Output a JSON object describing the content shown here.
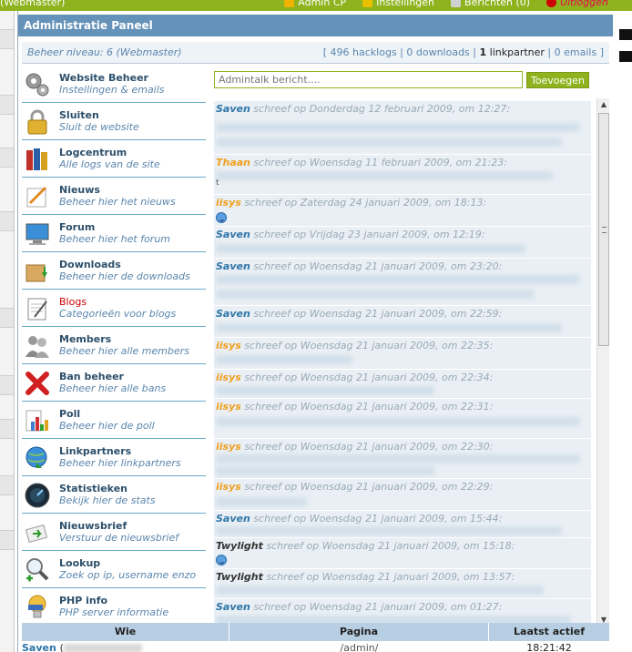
{
  "topbar": {
    "session": "(Webmaster)",
    "links": [
      {
        "label": "Admin CP",
        "icon": "admin-icon",
        "color": "#f2b200"
      },
      {
        "label": "Instellingen",
        "icon": "settings-icon",
        "color": "#e8c000"
      },
      {
        "label": "Berichten (0)",
        "icon": "messages-icon",
        "color": "#c0c0c0"
      },
      {
        "label": "Uitloggen",
        "icon": "logout-icon",
        "color": "#cc0000"
      }
    ]
  },
  "panel": {
    "title": "Administratie Paneel",
    "level": "Beheer niveau: 6 (Webmaster)",
    "stats": {
      "hacklogs": "496 hacklogs",
      "downloads": "0 downloads",
      "linkpartner_count": "1",
      "linkpartner_label": "linkpartner",
      "emails": "0 emails"
    }
  },
  "menu": [
    {
      "title": "Website Beheer",
      "sub": "Instellingen & emails",
      "icon": "gears-icon"
    },
    {
      "title": "Sluiten",
      "sub": "Sluit de website",
      "icon": "lock-icon"
    },
    {
      "title": "Logcentrum",
      "sub": "Alle logs van de site",
      "icon": "books-icon"
    },
    {
      "title": "Nieuws",
      "sub": "Beheer hier het nieuws",
      "icon": "news-icon"
    },
    {
      "title": "Forum",
      "sub": "Beheer hier het forum",
      "icon": "monitor-icon"
    },
    {
      "title": "Downloads",
      "sub": "Beheer hier de downloads",
      "icon": "box-download-icon"
    },
    {
      "title": "Blogs",
      "sub": "Categorieën voor blogs",
      "icon": "notepad-icon",
      "active": true
    },
    {
      "title": "Members",
      "sub": "Beheer hier alle members",
      "icon": "users-icon"
    },
    {
      "title": "Ban beheer",
      "sub": "Beheer hier alle bans",
      "icon": "ban-icon"
    },
    {
      "title": "Poll",
      "sub": "Beheer hier de poll",
      "icon": "poll-chart-icon"
    },
    {
      "title": "Linkpartners",
      "sub": "Beheer hier linkpartners",
      "icon": "globe-link-icon"
    },
    {
      "title": "Statistieken",
      "sub": "Bekijk hier de stats",
      "icon": "gauge-icon"
    },
    {
      "title": "Nieuwsbrief",
      "sub": "Verstuur de nieuwsbrief",
      "icon": "newsletter-icon"
    },
    {
      "title": "Lookup",
      "sub": "Zoek op ip, username enzo",
      "icon": "magnifier-icon"
    },
    {
      "title": "PHP info",
      "sub": "PHP server informatie",
      "icon": "php-info-icon"
    }
  ],
  "chat": {
    "placeholder": "Admintalk bericht....",
    "submit": "Toevoegen",
    "messages": [
      {
        "user": "Saven",
        "color": "blue",
        "meta": "schreef op Donderdag 12 februari 2009, om 12:27:"
      },
      {
        "user": "Thaan",
        "color": "orange",
        "meta": "schreef op Woensdag 11 februari 2009, om 21:23:",
        "lead_text": "t"
      },
      {
        "user": "iisys",
        "color": "orange",
        "meta": "schreef op Zaterdag 24 januari 2009, om 18:13:",
        "smile": true
      },
      {
        "user": "Saven",
        "color": "blue",
        "meta": "schreef op Vrijdag 23 januari 2009, om 12:19:"
      },
      {
        "user": "Saven",
        "color": "blue",
        "meta": "schreef op Woensdag 21 januari 2009, om 23:20:"
      },
      {
        "user": "Saven",
        "color": "blue",
        "meta": "schreef op Woensdag 21 januari 2009, om 22:59:"
      },
      {
        "user": "iisys",
        "color": "orange",
        "meta": "schreef op Woensdag 21 januari 2009, om 22:35:"
      },
      {
        "user": "iisys",
        "color": "orange",
        "meta": "schreef op Woensdag 21 januari 2009, om 22:34:"
      },
      {
        "user": "iisys",
        "color": "orange",
        "meta": "schreef op Woensdag 21 januari 2009, om 22:31:"
      },
      {
        "user": "iisys",
        "color": "orange",
        "meta": "schreef op Woensdag 21 januari 2009, om 22:30:"
      },
      {
        "user": "iisys",
        "color": "orange",
        "meta": "schreef op Woensdag 21 januari 2009, om 22:29:"
      },
      {
        "user": "Saven",
        "color": "blue",
        "meta": "schreef op Woensdag 21 januari 2009, om 15:44:"
      },
      {
        "user": "Twylight",
        "color": "dark",
        "meta": "schreef op Woensdag 21 januari 2009, om 15:18:",
        "smile": true
      },
      {
        "user": "Twylight",
        "color": "dark",
        "meta": "schreef op Woensdag 21 januari 2009, om 13:57:"
      },
      {
        "user": "Saven",
        "color": "blue",
        "meta": "schreef op Woensdag 21 januari 2009, om 01:27:"
      }
    ]
  },
  "online": {
    "headers": [
      "Wie",
      "Pagina",
      "Laatst actief"
    ],
    "rows": [
      {
        "user": "Saven",
        "open_paren": "(",
        "page": "/admin/",
        "time": "18:21:42"
      }
    ]
  }
}
